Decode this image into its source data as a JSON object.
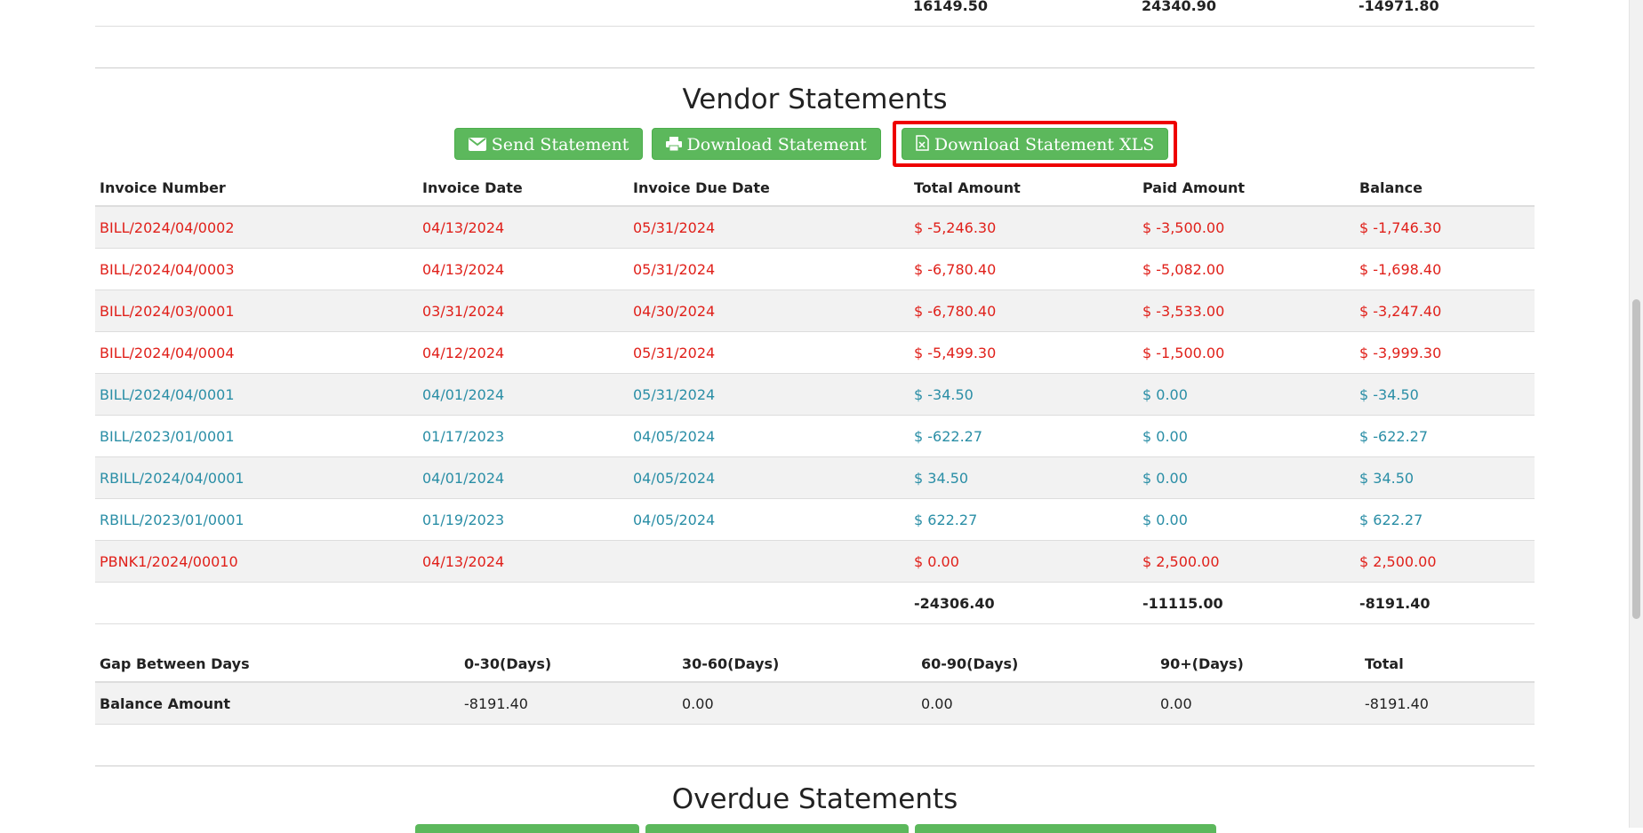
{
  "prev_totals": {
    "total": "16149.50",
    "paid": "24340.90",
    "balance": "-14971.80"
  },
  "vendor": {
    "title": "Vendor Statements",
    "buttons": {
      "send": "Send Statement",
      "download": "Download Statement",
      "xls": "Download Statement XLS"
    },
    "headers": [
      "Invoice Number",
      "Invoice Date",
      "Invoice Due Date",
      "Total Amount",
      "Paid Amount",
      "Balance"
    ],
    "rows": [
      [
        "BILL/2024/04/0002",
        "04/13/2024",
        "05/31/2024",
        "$ -5,246.30",
        "$ -3,500.00",
        "$ -1,746.30"
      ],
      [
        "BILL/2024/04/0003",
        "04/13/2024",
        "05/31/2024",
        "$ -6,780.40",
        "$ -5,082.00",
        "$ -1,698.40"
      ],
      [
        "BILL/2024/03/0001",
        "03/31/2024",
        "04/30/2024",
        "$ -6,780.40",
        "$ -3,533.00",
        "$ -3,247.40"
      ],
      [
        "BILL/2024/04/0004",
        "04/12/2024",
        "05/31/2024",
        "$ -5,499.30",
        "$ -1,500.00",
        "$ -3,999.30"
      ],
      [
        "BILL/2024/04/0001",
        "04/01/2024",
        "05/31/2024",
        "$ -34.50",
        "$ 0.00",
        "$ -34.50"
      ],
      [
        "BILL/2023/01/0001",
        "01/17/2023",
        "04/05/2024",
        "$ -622.27",
        "$ 0.00",
        "$ -622.27"
      ],
      [
        "RBILL/2024/04/0001",
        "04/01/2024",
        "04/05/2024",
        "$ 34.50",
        "$ 0.00",
        "$ 34.50"
      ],
      [
        "RBILL/2023/01/0001",
        "01/19/2023",
        "04/05/2024",
        "$ 622.27",
        "$ 0.00",
        "$ 622.27"
      ],
      [
        "PBNK1/2024/00010",
        "04/13/2024",
        "",
        "$ 0.00",
        "$ 2,500.00",
        "$ 2,500.00"
      ]
    ],
    "totals": {
      "total": "-24306.40",
      "paid": "-11115.00",
      "balance": "-8191.40"
    }
  },
  "gap": {
    "headers": [
      "Gap Between Days",
      "0-30(Days)",
      "30-60(Days)",
      "60-90(Days)",
      "90+(Days)",
      "Total"
    ],
    "row": [
      "Balance Amount",
      "-8191.40",
      "0.00",
      "0.00",
      "0.00",
      "-8191.40"
    ]
  },
  "overdue": {
    "title": "Overdue Statements"
  },
  "colors": {
    "button": "#5cb85c",
    "overdue_text": "#e0201a",
    "current_text": "#2a8ea6",
    "highlight": "#e00000"
  }
}
